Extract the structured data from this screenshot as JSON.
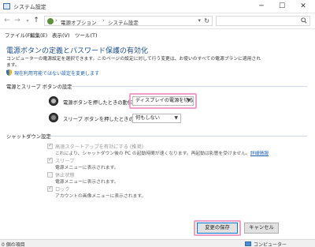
{
  "window": {
    "title": "システム設定",
    "minimize": "─",
    "maximize": "☐",
    "close": "✕"
  },
  "address": {
    "crumb1": "電源オプション",
    "crumb2": "システム設定",
    "sep": "›",
    "search_placeholder": ""
  },
  "menu": {
    "file": "ファイル(F)",
    "edit": "編集(E)",
    "view": "表示(V)",
    "tools": "ツール(T)"
  },
  "page": {
    "heading": "電源ボタンの定義とパスワード保護の有効化",
    "desc1": "コンピューターの電源設定を選択できます。このページの設定に対して行う変更は、お使いのすべての電源プランに適用され",
    "desc2": "ます。",
    "unavailable_link": "現在利用可能ではない設定を変更します"
  },
  "power_section": {
    "title": "電源とスリープ ボタンの設定",
    "power_label": "電源ボタンを押したときの動作:",
    "power_value": "ディスプレイの電源を切る",
    "sleep_label": "スリープ ボタンを押したときの動作:",
    "sleep_value": "何もしない"
  },
  "shutdown_section": {
    "title": "シャットダウン設定",
    "fast_startup_label": "高速スタートアップを有効にする (推奨)",
    "fast_startup_desc": "これにより、シャットダウン後の PC の起動時間が速くなります。再起動は影響を受けません。",
    "fast_startup_link": "詳細情報",
    "sleep_label": "スリープ",
    "sleep_desc": "電源メニューに表示されます。",
    "hibernate_label": "休止状態",
    "hibernate_desc": "電源メニューに表示されます。",
    "lock_label": "ロック",
    "lock_desc": "アカウントの画像メニューに表示されます。",
    "fast_startup_checked": true,
    "sleep_checked": true,
    "hibernate_checked": false,
    "lock_checked": true
  },
  "buttons": {
    "save": "変更の保存",
    "cancel": "キャンセル"
  },
  "status": {
    "items": "0 個の項目",
    "location": "コンピューター"
  },
  "colors": {
    "highlight": "#f0a0c8",
    "link": "#1a5fb4",
    "heading": "#1e4e8c"
  }
}
